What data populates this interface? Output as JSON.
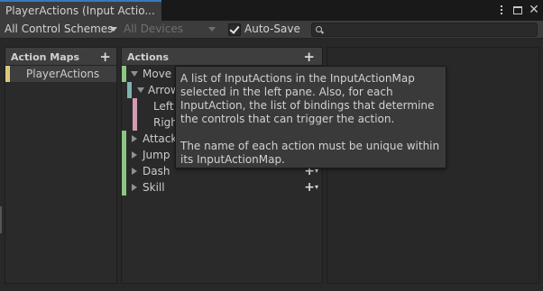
{
  "window": {
    "tab_title": "PlayerActions (Input Actio...",
    "icons": [
      "more-options-icon",
      "maximize-icon",
      "close-icon"
    ]
  },
  "toolbar": {
    "control_schemes": "All Control Schemes",
    "devices": "All Devices",
    "auto_save_label": "Auto-Save",
    "auto_save_checked": true,
    "search_value": ""
  },
  "action_maps": {
    "header": "Action Maps",
    "add_label": "+",
    "items": [
      {
        "label": "PlayerActions",
        "selected": true,
        "color": "#dbc97c"
      }
    ]
  },
  "actions": {
    "header": "Actions",
    "add_label": "+",
    "items": [
      {
        "label": "Move",
        "kind": "action",
        "expanded": true
      },
      {
        "label": "Arrow",
        "kind": "composite",
        "expanded": true
      },
      {
        "label": "Left:",
        "kind": "binding"
      },
      {
        "label": "Righ",
        "kind": "binding"
      },
      {
        "label": "Attack",
        "kind": "action",
        "expanded": false
      },
      {
        "label": "Jump",
        "kind": "action",
        "expanded": false
      },
      {
        "label": "Dash",
        "kind": "action",
        "expanded": false
      },
      {
        "label": "Skill",
        "kind": "action",
        "expanded": false
      }
    ]
  },
  "tooltip": {
    "paragraph1": "A list of InputActions in the InputActionMap selected in the left pane. Also, for each InputAction, the list of bindings that determine the controls that can trigger the action.",
    "paragraph2": "The name of each action must be unique within its InputActionMap."
  },
  "colors": {
    "accent_tab": "#3a79bb",
    "action_map": "#dbc97c",
    "action": "#8dc682",
    "composite": "#7fb2b3",
    "binding": "#d29bb1"
  }
}
